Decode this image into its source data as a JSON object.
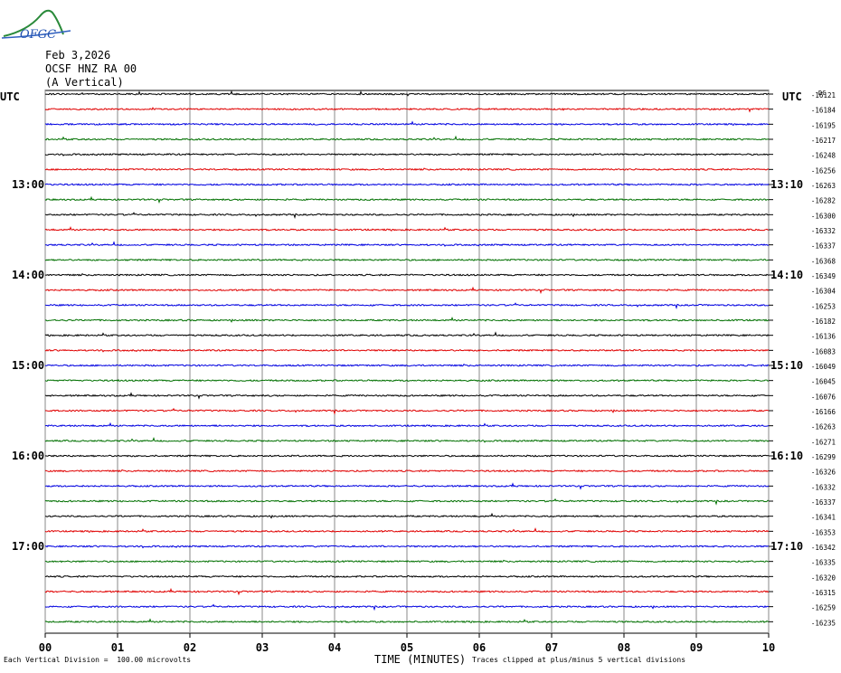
{
  "header": {
    "logo_text": "OFGC",
    "date": "Feb 3,2026",
    "station": "OCSF HNZ RA 00",
    "component": "(A Vertical)",
    "utc_left": "UTC",
    "utc_right": "UTC",
    "dc_label": "DC"
  },
  "footer": {
    "scale_note": "Each Vertical Division =  100.00 microvolts",
    "clip_note": "Traces clipped at plus/minus 5 vertical divisions",
    "xaxis_title": "TIME (MINUTES)"
  },
  "chart_data": {
    "type": "line",
    "title": "",
    "xlabel": "TIME (MINUTES)",
    "xlim": [
      0,
      10
    ],
    "x_ticks": [
      "00",
      "01",
      "02",
      "03",
      "04",
      "05",
      "06",
      "07",
      "08",
      "09",
      "10"
    ],
    "left_time_labels": [
      "13:00",
      "14:00",
      "15:00",
      "16:00",
      "17:00"
    ],
    "right_time_labels": [
      "13:10",
      "14:10",
      "15:10",
      "16:10",
      "17:10"
    ],
    "trace_colors": [
      "#000000",
      "#e00000",
      "#0000e0",
      "#007000"
    ],
    "trace_dc_offsets": [
      -16121,
      -16184,
      -16195,
      -16217,
      -16248,
      -16256,
      -16263,
      -16282,
      -16300,
      -16332,
      -16337,
      -16368,
      -16349,
      -16304,
      -16253,
      -16182,
      -16136,
      -16083,
      -16049,
      -16045,
      -16076,
      -16166,
      -16263,
      -16271,
      -16299,
      -16326,
      -16332,
      -16337,
      -16341,
      -16353,
      -16342,
      -16335,
      -16320,
      -16315,
      -16259,
      -16235
    ],
    "grid": true
  }
}
